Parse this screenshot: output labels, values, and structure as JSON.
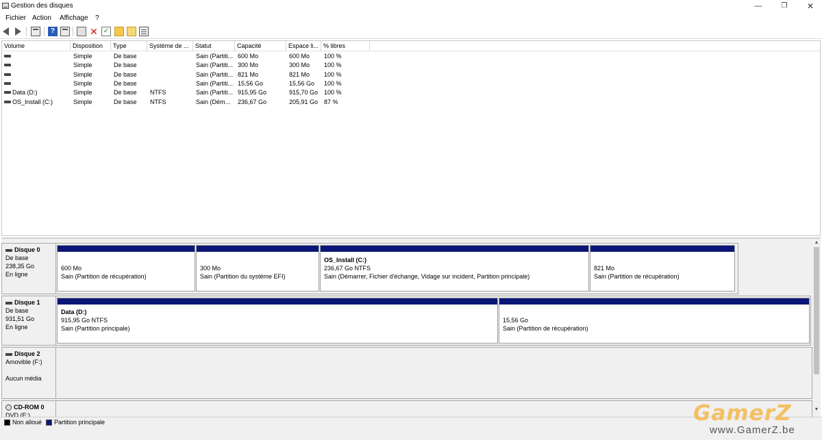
{
  "window": {
    "title": "Gestion des disques",
    "minimize": "—",
    "maximize": "❐",
    "close": "✕"
  },
  "menu": [
    "Fichier",
    "Action",
    "Affichage",
    "?"
  ],
  "list": {
    "columns": [
      "Volume",
      "Disposition",
      "Type",
      "Système de ...",
      "Statut",
      "Capacité",
      "Espace li...",
      "% libres"
    ],
    "rows": [
      [
        "",
        "Simple",
        "De base",
        "",
        "Sain (Partiti...",
        "600 Mo",
        "600 Mo",
        "100 %"
      ],
      [
        "",
        "Simple",
        "De base",
        "",
        "Sain (Partiti...",
        "300 Mo",
        "300 Mo",
        "100 %"
      ],
      [
        "",
        "Simple",
        "De base",
        "",
        "Sain (Partiti...",
        "821 Mo",
        "821 Mo",
        "100 %"
      ],
      [
        "",
        "Simple",
        "De base",
        "",
        "Sain (Partiti...",
        "15,56 Go",
        "15,56 Go",
        "100 %"
      ],
      [
        "Data (D:)",
        "Simple",
        "De base",
        "NTFS",
        "Sain (Partiti...",
        "915,95 Go",
        "915,70 Go",
        "100 %"
      ],
      [
        "OS_Install (C:)",
        "Simple",
        "De base",
        "NTFS",
        "Sain (Dém...",
        "236,67 Go",
        "205,91 Go",
        "87 %"
      ]
    ]
  },
  "disks": [
    {
      "name": "Disque 0",
      "type": "De base",
      "size": "238,35 Go",
      "state": "En ligne",
      "partitions": [
        {
          "name": "",
          "size": "600 Mo",
          "status": "Sain (Partition de récupération)"
        },
        {
          "name": "",
          "size": "300 Mo",
          "status": "Sain (Partition du système EFI)"
        },
        {
          "name": "OS_Install  (C:)",
          "size": "236,67 Go NTFS",
          "status": "Sain (Démarrer, Fichier d'échange, Vidage sur incident, Partition principale)"
        },
        {
          "name": "",
          "size": "821 Mo",
          "status": "Sain (Partition de récupération)"
        }
      ]
    },
    {
      "name": "Disque 1",
      "type": "De base",
      "size": "931,51 Go",
      "state": "En ligne",
      "partitions": [
        {
          "name": "Data  (D:)",
          "size": "915,95 Go NTFS",
          "status": "Sain (Partition principale)"
        },
        {
          "name": "",
          "size": "15,56 Go",
          "status": "Sain (Partition de récupération)"
        }
      ]
    },
    {
      "name": "Disque 2",
      "type": "Amovible (F:)",
      "size": "",
      "state": "Aucun média",
      "partitions": []
    },
    {
      "name": "CD-ROM 0",
      "type": "DVD (E:)",
      "size": "",
      "state": "",
      "partitions": []
    }
  ],
  "legend": [
    {
      "label": "Non alloué",
      "color": "#000000"
    },
    {
      "label": "Partition principale",
      "color": "#0b1776"
    }
  ],
  "watermark": {
    "logo": "GamerZ",
    "url": "www.GamerZ.be"
  }
}
